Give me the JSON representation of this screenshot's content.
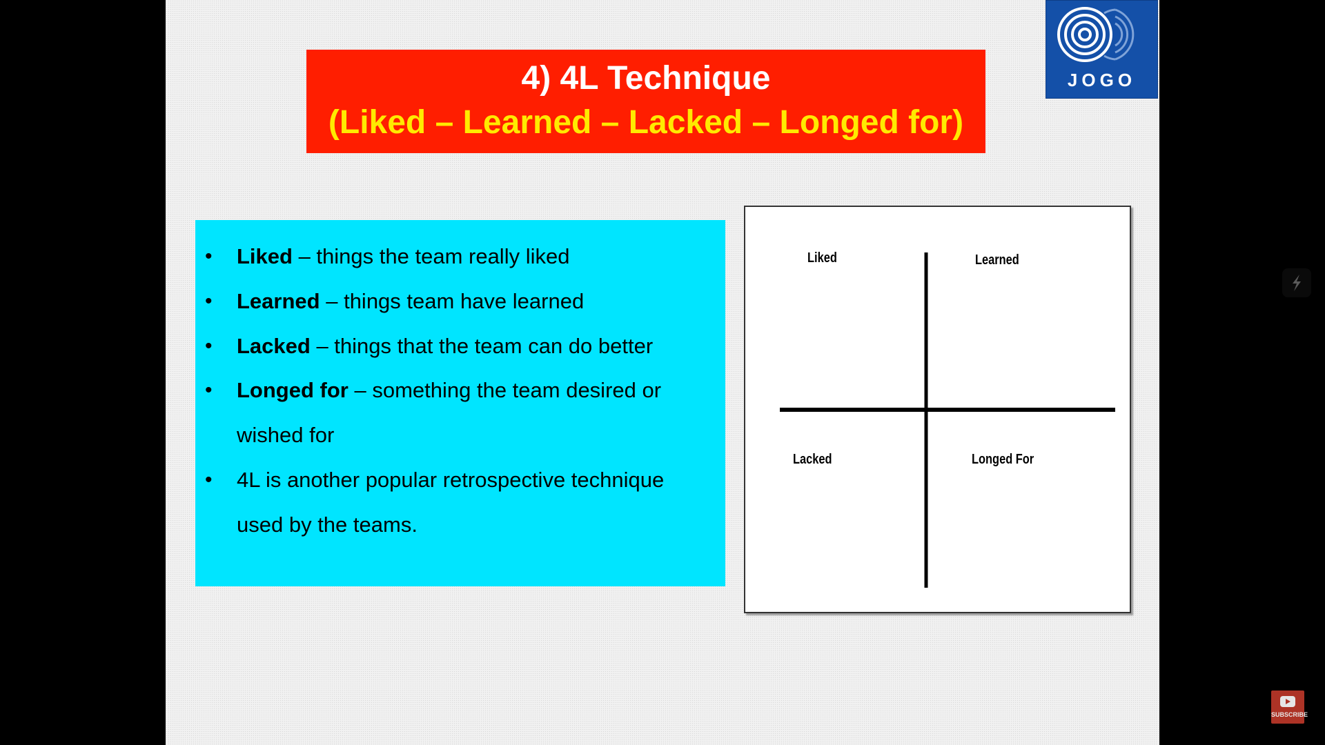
{
  "slide": {
    "title": {
      "line1": "4) 4L Technique",
      "line2": "(Liked – Learned – Lacked – Longed for)"
    },
    "logo": {
      "text": "JOGO"
    },
    "bullets": [
      {
        "bold": "Liked",
        "rest": " – things the team really liked"
      },
      {
        "bold": "Learned",
        "rest": " – things team have learned"
      },
      {
        "bold": "Lacked",
        "rest": " – things that the team can do better"
      },
      {
        "bold": "Longed for",
        "rest": " – something the team desired or wished for"
      },
      {
        "bold": "",
        "rest": "4L is another popular retrospective technique used by the teams."
      }
    ],
    "quadrant": {
      "top_left": "Liked",
      "top_right": "Learned",
      "bottom_left": "Lacked",
      "bottom_right": "Longed For"
    }
  },
  "overlay": {
    "subscribe_label": "SUBSCRIBE"
  },
  "colors": {
    "title_bg": "#ff1e00",
    "title_line2": "#ffea00",
    "panel_bg": "#00e5ff",
    "logo_bg": "#1450a8"
  },
  "icons": {
    "logo": "concentric-rings-icon",
    "subscribe": "youtube-play-icon",
    "side": "lightning-icon"
  }
}
